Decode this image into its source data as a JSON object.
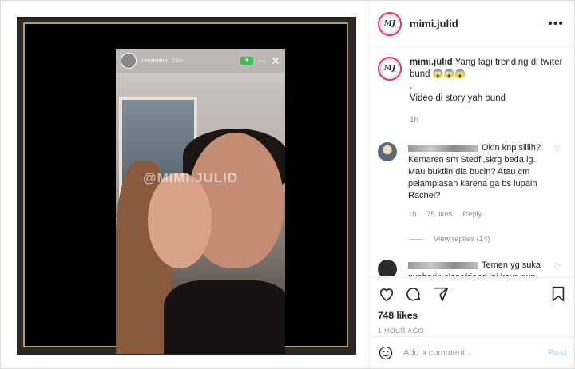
{
  "post": {
    "username": "mimi.julid",
    "avatar_initials": "MJ",
    "more_icon": "more-horizontal-icon",
    "watermark": "@MIMI.JULID",
    "story": {
      "username": "cintakilikut",
      "time": "21m"
    }
  },
  "caption": {
    "username": "mimi.julid",
    "text_line1": "Yang lagi trending di twiter bund",
    "emoji": "😱😱😱",
    "text_line2": ".",
    "text_line3": "Video di story yah bund",
    "time": "1h"
  },
  "comments": [
    {
      "text": "Okin knp siiiih? Kemaren sm Stedfi,skrg beda lg. Mau buktiin dia bucin? Atau cm pelampiasan karena ga bs lupain Rachel?",
      "time": "1h",
      "likes": "75 likes",
      "reply": "Reply",
      "view_replies": "View replies (14)"
    },
    {
      "text": "Temen yg suka nyebarin closefriend ini kaya nya hidup nya kurang attention deh"
    }
  ],
  "actions": {
    "icons": [
      "heart-icon",
      "comment-icon",
      "share-icon",
      "bookmark-icon"
    ],
    "likes": "748 likes",
    "time_ago": "1 HOUR AGO"
  },
  "add_comment": {
    "placeholder": "Add a comment...",
    "post_label": "Post"
  },
  "colors": {
    "link_disabled": "#b2dffc",
    "frame_gold": "#b79a5c",
    "story_ring": "#e1306c"
  }
}
